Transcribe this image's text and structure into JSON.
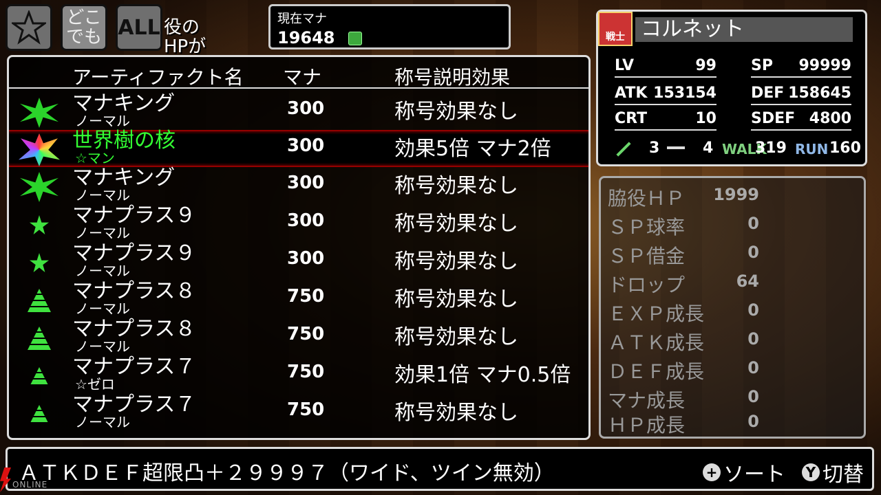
{
  "top_buttons": {
    "dokodemo_label": "どこでも",
    "all_label": "ALL"
  },
  "peek_text": "役の\nHPが",
  "mana": {
    "label": "現在マナ",
    "value": "19648"
  },
  "list": {
    "headers": {
      "name": "アーティファクト名",
      "mana": "マナ",
      "effect": "称号説明効果"
    },
    "rows": [
      {
        "name": "マナキング",
        "rarity": "ノーマル",
        "mana": "300",
        "effect": "称号効果なし",
        "icon": "burst-icon"
      },
      {
        "name": "世界樹の核",
        "rarity": "☆マン",
        "mana": "300",
        "effect": "効果5倍 マナ2倍",
        "icon": "world-tree-core-icon"
      },
      {
        "name": "マナキング",
        "rarity": "ノーマル",
        "mana": "300",
        "effect": "称号効果なし",
        "icon": "burst-icon"
      },
      {
        "name": "マナプラス９",
        "rarity": "ノーマル",
        "mana": "300",
        "effect": "称号効果なし",
        "icon": "star-icon"
      },
      {
        "name": "マナプラス９",
        "rarity": "ノーマル",
        "mana": "300",
        "effect": "称号効果なし",
        "icon": "star-icon"
      },
      {
        "name": "マナプラス８",
        "rarity": "ノーマル",
        "mana": "750",
        "effect": "称号効果なし",
        "icon": "pyramid-icon"
      },
      {
        "name": "マナプラス８",
        "rarity": "ノーマル",
        "mana": "750",
        "effect": "称号効果なし",
        "icon": "pyramid-icon"
      },
      {
        "name": "マナプラス７",
        "rarity": "☆ゼロ",
        "mana": "750",
        "effect": "効果1倍 マナ0.5倍",
        "icon": "pyramid-small-icon"
      },
      {
        "name": "マナプラス７",
        "rarity": "ノーマル",
        "mana": "750",
        "effect": "称号効果なし",
        "icon": "pyramid-small-icon"
      }
    ]
  },
  "character": {
    "class_label": "戦士",
    "name": "コルネット",
    "lv_key": "LV",
    "lv": "99",
    "sp_key": "SP",
    "sp": "99999",
    "atk_key": "ATK",
    "atk": "153154",
    "def_key": "DEF",
    "def": "158645",
    "crt_key": "CRT",
    "crt": "10",
    "sdef_key": "SDEF",
    "sdef": "4800",
    "weapon_a": "3",
    "weapon_b": "4",
    "walk_key": "WALK",
    "walk": "319",
    "run_key": "RUN",
    "run": "160"
  },
  "sub_stats": [
    {
      "key": "脇役ＨＰ",
      "value": "1999"
    },
    {
      "key": "ＳＰ球率",
      "value": "0"
    },
    {
      "key": "ＳＰ借金",
      "value": "0"
    },
    {
      "key": "ドロップ",
      "value": "64"
    },
    {
      "key": "ＥＸＰ成長",
      "value": "0"
    },
    {
      "key": "ＡＴＫ成長",
      "value": "0"
    },
    {
      "key": "ＤＥＦ成長",
      "value": "0"
    },
    {
      "key": "マナ成長",
      "value": "0"
    },
    {
      "key": "ＨＰ成長",
      "value": "0"
    }
  ],
  "bottom": {
    "description": "ＡＴＫＤＥＦ超限凸＋２９９９７（ワイド、ツイン無効）",
    "sort_button": "+",
    "sort_label": "ソート",
    "switch_button": "Y",
    "switch_label": "切替"
  },
  "logo_text": "ONLINE"
}
